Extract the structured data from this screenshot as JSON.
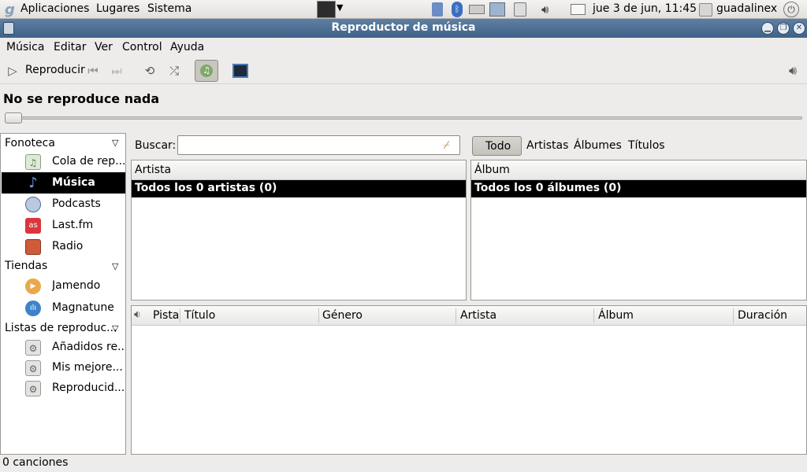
{
  "panel": {
    "menu_apps": "Aplicaciones",
    "menu_places": "Lugares",
    "menu_system": "Sistema",
    "clock": "jue  3 de jun, 11:45",
    "user": "guadalinex"
  },
  "window": {
    "title": "Reproductor de música"
  },
  "menubar": {
    "items": [
      "Música",
      "Editar",
      "Ver",
      "Control",
      "Ayuda"
    ]
  },
  "toolbar": {
    "play_label": "Reproducir"
  },
  "now_playing": "No se reproduce nada",
  "sidebar": {
    "library_header": "Fonoteca",
    "library_items": [
      "Cola de rep...",
      "Música",
      "Podcasts",
      "Last.fm",
      "Radio"
    ],
    "stores_header": "Tiendas",
    "stores_items": [
      "Jamendo",
      "Magnatune"
    ],
    "playlists_header": "Listas de reproduc...",
    "playlists_items": [
      "Añadidos re...",
      "Mis mejore...",
      "Reproducid..."
    ]
  },
  "browser": {
    "search_label": "Buscar:",
    "search_value": "",
    "filters": [
      "Todo",
      "Artistas",
      "Álbumes",
      "Títulos"
    ],
    "artist_header": "Artista",
    "artist_row": "Todos los 0 artistas (0)",
    "album_header": "Álbum",
    "album_row": "Todos los 0 álbumes (0)"
  },
  "tracklist": {
    "columns": [
      "Pista",
      "Título",
      "Género",
      "Artista",
      "Álbum",
      "Duración"
    ]
  },
  "status": "0 canciones"
}
